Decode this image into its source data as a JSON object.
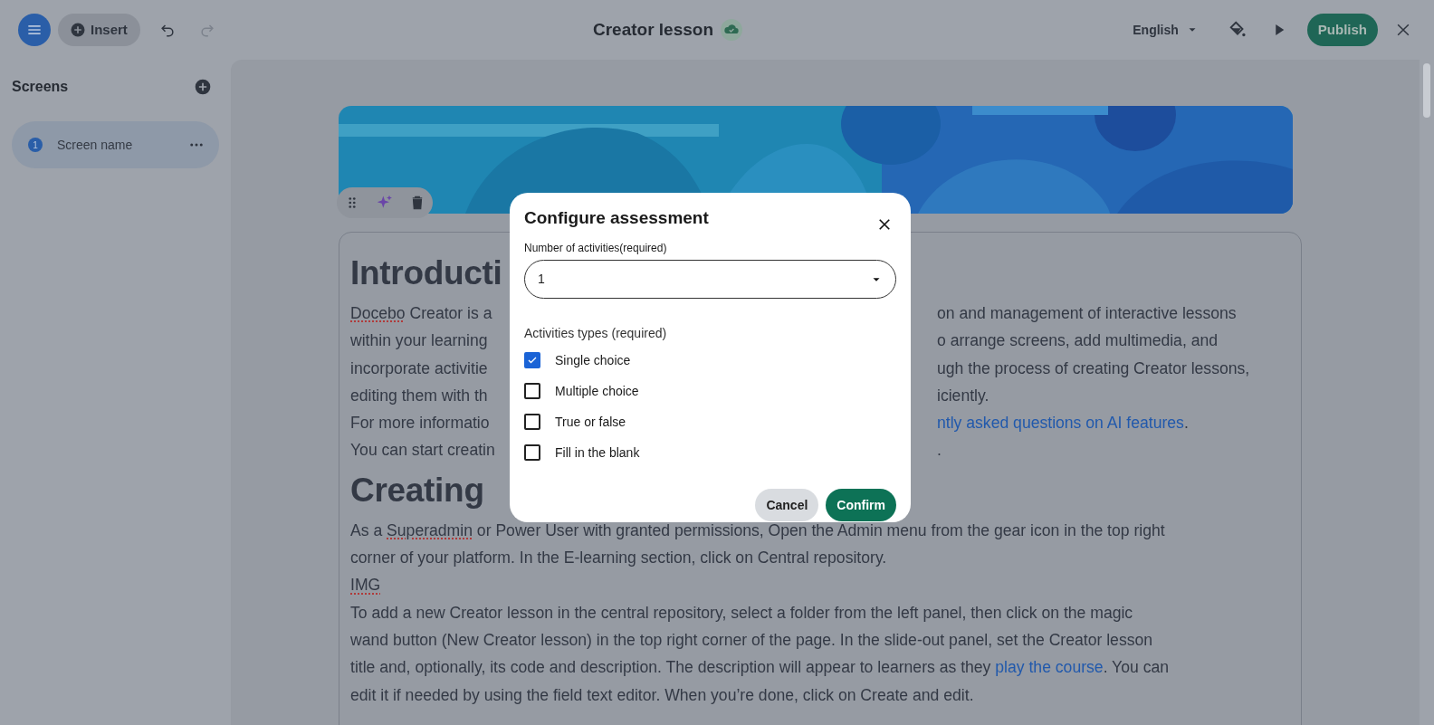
{
  "toolbar": {
    "insert_label": "Insert",
    "title": "Creator lesson",
    "language": "English",
    "publish_label": "Publish"
  },
  "sidebar": {
    "title": "Screens",
    "items": [
      {
        "number": "1",
        "label": "Screen name",
        "selected": true
      }
    ]
  },
  "document": {
    "blocks": [
      {
        "kind": "heading",
        "left": "Introducti"
      },
      {
        "kind": "split",
        "left": [
          {
            "text": "Docebo",
            "misspelled": true
          },
          {
            "text": " Creator is a"
          }
        ],
        "right": [
          {
            "text": "on and management of interactive lessons"
          }
        ]
      },
      {
        "kind": "split",
        "left": [
          {
            "text": "within your learning"
          }
        ],
        "right": [
          {
            "text": "o arrange screens, add multimedia, and"
          }
        ]
      },
      {
        "kind": "split",
        "left": [
          {
            "text": "incorporate activitie"
          }
        ],
        "right": [
          {
            "text": "ugh the process of creating Creator lessons,"
          }
        ]
      },
      {
        "kind": "split",
        "left": [
          {
            "text": "editing them with th"
          }
        ],
        "right": [
          {
            "text": "iciently."
          }
        ]
      },
      {
        "kind": "split",
        "left": [
          {
            "text": "For more informatio"
          }
        ],
        "right": [
          {
            "text": "ntly asked questions on AI features",
            "link": true
          },
          {
            "text": "."
          }
        ]
      },
      {
        "kind": "split",
        "left": [
          {
            "text": "You can start creatin"
          }
        ],
        "right": [
          {
            "text": "."
          }
        ]
      },
      {
        "kind": "heading",
        "left": "Creating"
      },
      {
        "kind": "full",
        "segments": [
          {
            "text": "As a "
          },
          {
            "text": "Superadmin",
            "misspelled": true
          },
          {
            "text": " or Power User with granted permissions, Open the Admin menu from the gear icon in the top right"
          }
        ]
      },
      {
        "kind": "full",
        "segments": [
          {
            "text": "corner of your platform. In the E-learning section, click on Central repository."
          }
        ]
      },
      {
        "kind": "full",
        "segments": [
          {
            "text": "IMG",
            "misspelled": true
          }
        ]
      },
      {
        "kind": "full",
        "segments": [
          {
            "text": "To add a new Creator lesson in the central repository, select a folder from the left panel, then click on the magic"
          }
        ]
      },
      {
        "kind": "full",
        "segments": [
          {
            "text": "wand button (New Creator lesson) in the top right corner of the page. In the slide-out panel, set the Creator lesson"
          }
        ]
      },
      {
        "kind": "full",
        "segments": [
          {
            "text": "title and, optionally, its code and description. The description will appear to learners as they "
          },
          {
            "text": "play the course",
            "link": true
          },
          {
            "text": ". You can"
          }
        ]
      },
      {
        "kind": "full",
        "segments": [
          {
            "text": "edit it if needed by using the field text editor. When you’re done, click on Create and edit."
          }
        ]
      }
    ]
  },
  "dialog": {
    "title": "Configure assessment",
    "count_label": "Number of activities(required)",
    "count_value": "1",
    "types_label": "Activities types (required)",
    "types": [
      {
        "label": "Single choice",
        "checked": true
      },
      {
        "label": "Multiple choice",
        "checked": false
      },
      {
        "label": "True or false",
        "checked": false
      },
      {
        "label": "Fill in the blank",
        "checked": false
      }
    ],
    "buttons": [
      {
        "label": "Cancel",
        "kind": "secondary"
      },
      {
        "label": "Confirm",
        "kind": "primary"
      }
    ]
  }
}
